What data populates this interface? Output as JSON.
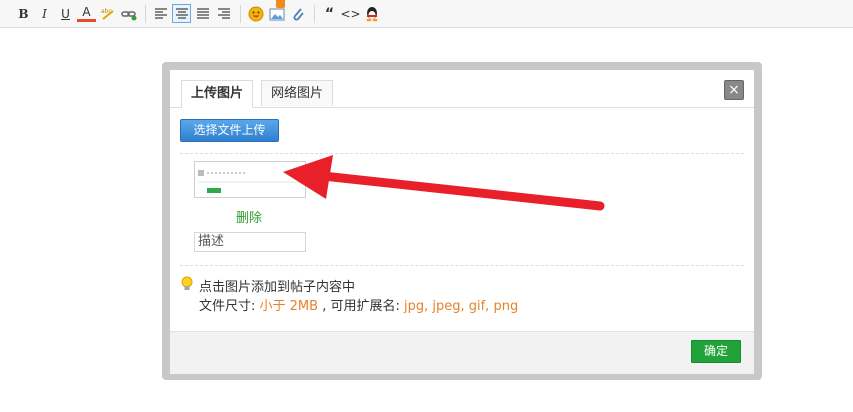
{
  "toolbar": {
    "bold": "B",
    "italic": "I",
    "underline": "U",
    "font_color": "A",
    "quote": "“",
    "code": "<>"
  },
  "dialog": {
    "tabs": [
      {
        "label": "上传图片",
        "active": true
      },
      {
        "label": "网络图片",
        "active": false
      }
    ],
    "close": "×",
    "upload_button": "选择文件上传",
    "delete_link": "删除",
    "description_placeholder": "描述",
    "tip": {
      "line1": "点击图片添加到帖子内容中",
      "size_label": "文件尺寸: ",
      "size_value": "小于 2MB",
      "ext_label": " , 可用扩展名: ",
      "ext_value": "jpg, jpeg, gif, png"
    },
    "confirm_button": "确定"
  },
  "colors": {
    "accent_blue": "#2f7fd0",
    "confirm_green": "#21a33a",
    "delete_green": "#2e9d2e",
    "highlight_orange": "#e6832a",
    "arrow_red": "#e8202a"
  },
  "icons": [
    "bold-icon",
    "italic-icon",
    "underline-icon",
    "font-color-icon",
    "spellcheck-icon",
    "link-icon",
    "align-left-icon",
    "align-center-icon",
    "align-justify-icon",
    "align-right-icon",
    "emoji-icon",
    "image-icon",
    "attachment-icon",
    "quote-icon",
    "code-icon",
    "qq-icon",
    "lightbulb-icon",
    "close-icon"
  ]
}
